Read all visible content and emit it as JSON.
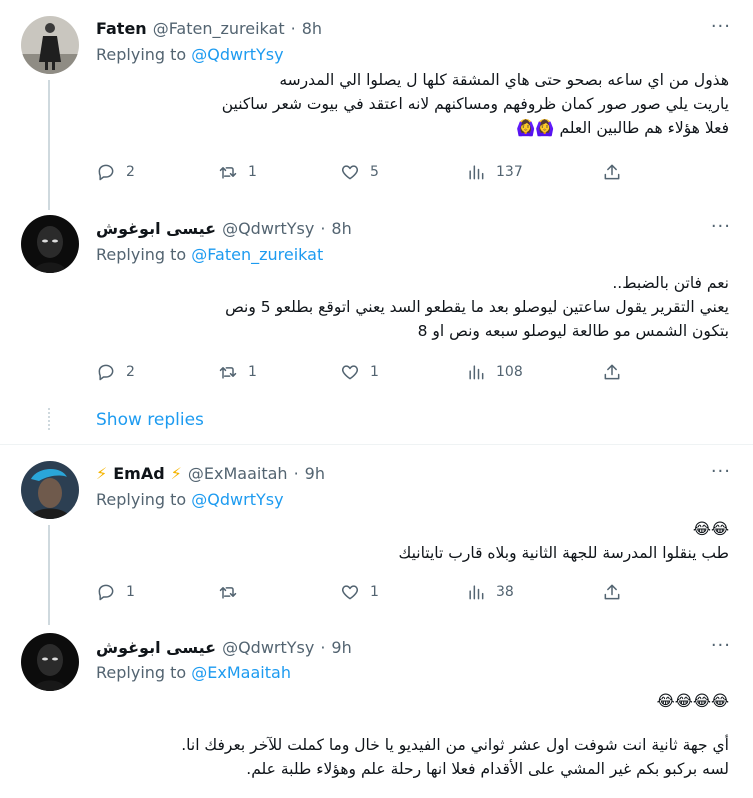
{
  "tweets": [
    {
      "author_name": "Faten",
      "author_handle": "@Faten_zureikat",
      "time": "8h",
      "replying_prefix": "Replying to",
      "replying_to": "@QdwrtYsy",
      "body_lines": [
        "هذول من اي ساعه بصحو حتى هاي المشقة كلها ل يصلوا الي المدرسه",
        "ياريت يلي صور صور كمان ظروفهم ومساكنهم لانه اعتقد  في بيوت شعر ساكنين",
        "فعلا هؤلاء هم طالبين العلم 🙆‍♀️🙆‍♀️"
      ],
      "replies": "2",
      "retweets": "1",
      "likes": "5",
      "views": "137"
    },
    {
      "author_name": "عيسى ابوغوش",
      "author_handle": "@QdwrtYsy",
      "time": "8h",
      "replying_prefix": "Replying to",
      "replying_to": "@Faten_zureikat",
      "body_lines": [
        "نعم فاتن بالضبط..",
        "يعني التقرير يقول ساعتين ليوصلو بعد ما يقطعو السد يعني اتوقع بطلعو 5 ونص",
        "بتكون الشمس مو طالعة ليوصلو سبعه ونص او 8"
      ],
      "replies": "2",
      "retweets": "1",
      "likes": "1",
      "views": "108"
    },
    {
      "author_name": "EmAd",
      "author_prefix": "⚡",
      "author_suffix": "⚡",
      "author_handle": "@ExMaaitah",
      "time": "9h",
      "replying_prefix": "Replying to",
      "replying_to": "@QdwrtYsy",
      "body_lines": [
        "😂😂",
        "طب ينقلوا المدرسة للجهة الثانية وبلاه قارب تايتانيك"
      ],
      "replies": "1",
      "retweets": "",
      "likes": "1",
      "views": "38"
    },
    {
      "author_name": "عيسى ابوغوش",
      "author_handle": "@QdwrtYsy",
      "time": "9h",
      "replying_prefix": "Replying to",
      "replying_to": "@ExMaaitah",
      "body_lines": [
        "😂😂😂😂",
        "أي جهة ثانية انت شوفت اول عشر ثواني من الفيديو يا خال وما كملت للآخر بعرفك انا.",
        "لسه بركبو بكم غير المشي على الأقدام فعلا انها رحلة علم وهؤلاء طلبة علم."
      ]
    }
  ],
  "show_replies_label": "Show replies",
  "dot": "·",
  "more_glyph": "···",
  "colors": {
    "accent": "#1d9bf0",
    "muted": "#536471",
    "text": "#0f1419",
    "divider": "#eff3f4"
  }
}
